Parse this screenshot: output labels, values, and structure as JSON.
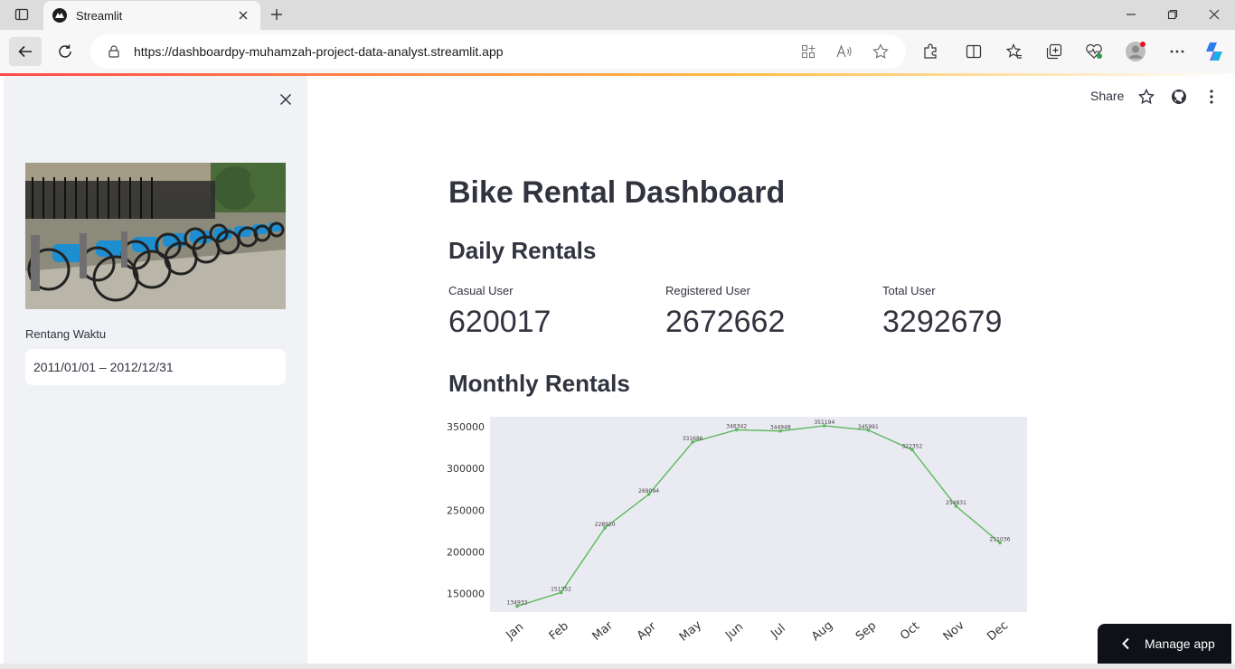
{
  "browser": {
    "tab_title": "Streamlit",
    "url": "https://dashboardpy-muhamzah-project-data-analyst.streamlit.app"
  },
  "sidebar": {
    "date_label": "Rentang Waktu",
    "date_value": "2011/01/01 – 2012/12/31"
  },
  "header": {
    "share_label": "Share"
  },
  "main": {
    "title": "Bike Rental Dashboard",
    "daily_heading": "Daily Rentals",
    "monthly_heading": "Monthly Rentals",
    "metrics": [
      {
        "label": "Casual User",
        "value": "620017"
      },
      {
        "label": "Registered User",
        "value": "2672662"
      },
      {
        "label": "Total User",
        "value": "3292679"
      }
    ]
  },
  "manage_app": {
    "label": "Manage app"
  },
  "chart_data": {
    "type": "line",
    "categories": [
      "Jan",
      "Feb",
      "Mar",
      "Apr",
      "May",
      "Jun",
      "Jul",
      "Aug",
      "Sep",
      "Oct",
      "Nov",
      "Dec"
    ],
    "values": [
      134933,
      151352,
      228920,
      269094,
      331686,
      346342,
      344948,
      351194,
      345991,
      322352,
      254831,
      211036
    ],
    "ytick_labels": [
      "150000",
      "200000",
      "250000",
      "300000",
      "350000"
    ],
    "ylim": [
      128000,
      362000
    ],
    "grid": false,
    "line_color": "#5cb85c",
    "background_color": "#eaeaf2",
    "xlabel": "",
    "ylabel": "",
    "title": ""
  }
}
